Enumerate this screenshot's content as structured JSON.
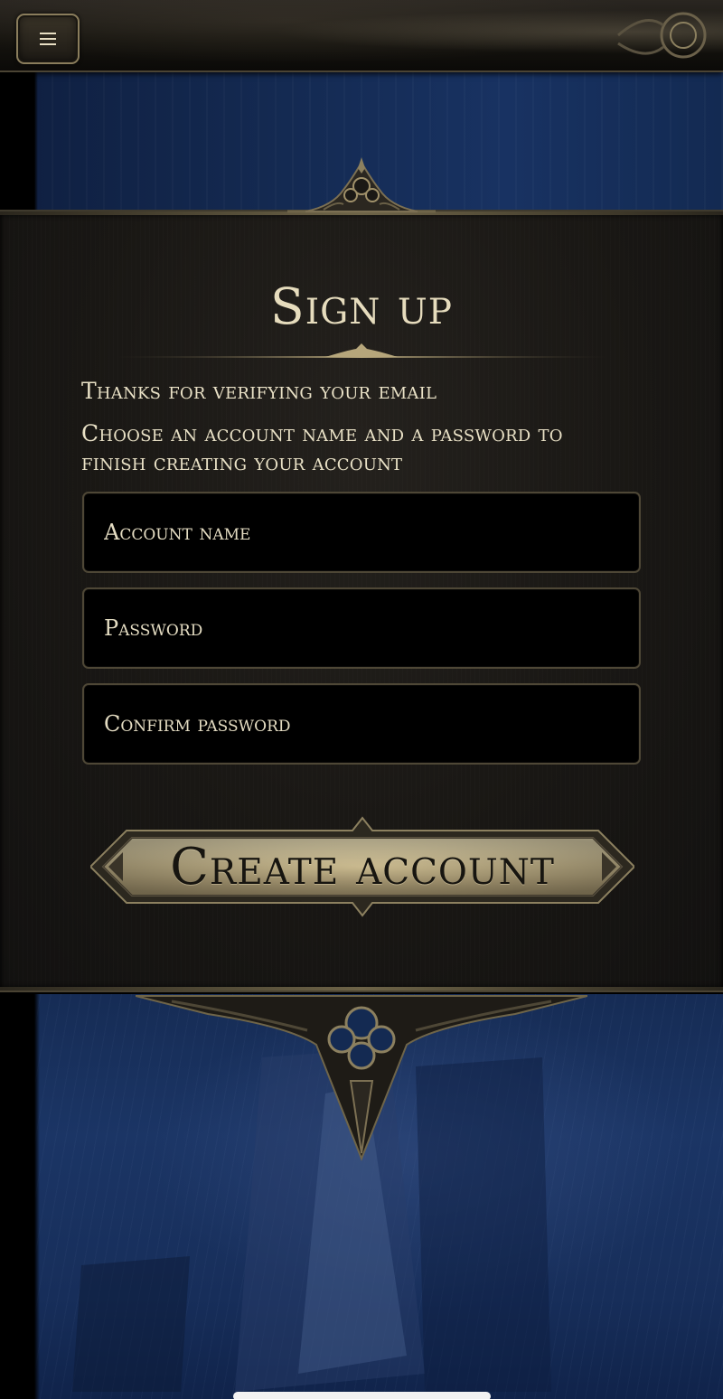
{
  "header": {
    "menu_icon": "hamburger-menu-icon"
  },
  "signup": {
    "title": "Sign up",
    "thanks_text": "Thanks for verifying your email",
    "instruction_line1": "Choose an account name and a password to",
    "instruction_line2": "finish creating your account",
    "account_name_placeholder": "Account name",
    "password_placeholder": "Password",
    "confirm_password_placeholder": "Confirm password",
    "create_button_label": "Create account"
  },
  "colors": {
    "panel": "#191714",
    "text": "#e9e1c6",
    "accent_gold": "#c9b98e",
    "scene_blue": "#183262"
  }
}
